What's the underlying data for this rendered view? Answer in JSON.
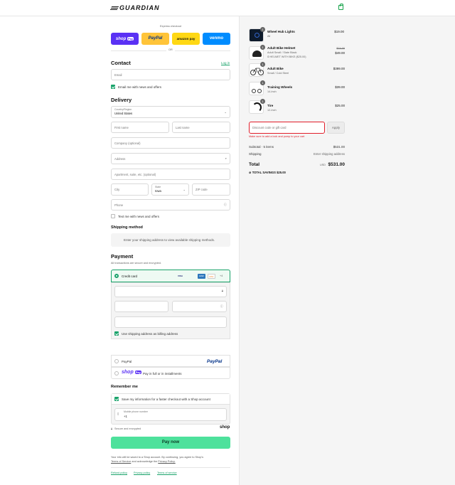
{
  "brand": {
    "name": "GUARDIAN"
  },
  "express": {
    "label": "Express checkout",
    "shop": "shop",
    "shop_pay": "Pay",
    "paypal": "PayPal",
    "amazon": "amazon pay",
    "venmo": "venmo",
    "or": "OR"
  },
  "contact": {
    "title": "Contact",
    "login": "Log in",
    "email_placeholder": "Email",
    "news": "Email me with news and offers"
  },
  "delivery": {
    "title": "Delivery",
    "country_label": "Country/Region",
    "country": "United States",
    "first": "First name",
    "last": "Last name",
    "company": "Company (optional)",
    "address": "Address",
    "apt": "Apartment, suite, etc. (optional)",
    "city": "City",
    "state_label": "State",
    "state": "Iowa",
    "zip": "ZIP code",
    "phone": "Phone",
    "text_me": "Text me with news and offers"
  },
  "shipping": {
    "title": "Shipping method",
    "note": "Enter your shipping address to view available shipping methods."
  },
  "payment": {
    "title": "Payment",
    "sub": "All transactions are secure and encrypted.",
    "credit": "Credit card",
    "cards": [
      "VISA",
      "MC",
      "AMEX",
      "DISC"
    ],
    "more": "+4",
    "billing": "Use shipping address as billing address",
    "paypal": "PayPal",
    "paypal_logo": "PayPal",
    "shop": "shop",
    "shop_pay": "Pay",
    "installments": "Pay in full or in installments"
  },
  "remember": {
    "title": "Remember me",
    "save": "Save my information for a faster checkout with a Shop account",
    "mobile_label": "Mobile phone number",
    "mobile_prefix": "+1",
    "secure": "Secure and encrypted",
    "shop": "shop"
  },
  "pay_button": "Pay now",
  "legal": {
    "line1": "Your info will be saved to a Shop account. By continuing, you agree to Shop's",
    "terms": "Terms of Service",
    "and": "and acknowledge the",
    "privacy": "Privacy Policy."
  },
  "footer": {
    "refund": "Refund policy",
    "privacy": "Privacy policy",
    "terms": "Terms of service"
  },
  "items": [
    {
      "name": "Wheel Hub Lights",
      "variant": "All",
      "qty": "1",
      "price": "$19.00",
      "old": ""
    },
    {
      "name": "Adult Bike Helmet",
      "variant": "Adult Small / Slate Black",
      "qty": "1",
      "price": "$49.00",
      "old": "$74.00",
      "bundle": "HELMET WITH BIKE ($25.00)"
    },
    {
      "name": "Adult Bike",
      "variant": "Small / Cold Steel",
      "qty": "1",
      "price": "$399.00",
      "old": ""
    },
    {
      "name": "Training Wheels",
      "variant": "14-Inch",
      "qty": "1",
      "price": "$39.00",
      "old": ""
    },
    {
      "name": "Tire",
      "variant": "12-Inch",
      "qty": "1",
      "price": "$25.00",
      "old": ""
    }
  ],
  "discount": {
    "placeholder": "Discount code or gift card",
    "apply": "Apply",
    "error": "Make sure to add a lock and pump to your cart"
  },
  "summary": {
    "subtotal_label": "Subtotal · 5 items",
    "subtotal": "$531.00",
    "shipping_label": "Shipping",
    "shipping": "Enter shipping address",
    "total_label": "Total",
    "currency": "USD",
    "total": "$531.00",
    "savings_label": "TOTAL SAVINGS",
    "savings": "$25.00"
  },
  "colors": {
    "accent": "#1aa36b",
    "pay_button": "#4ee19c",
    "error": "#e11d2a",
    "shop_pay": "#5a31f4",
    "paypal_btn": "#ffc439",
    "amazon_btn": "#ffd814",
    "venmo_btn": "#008cff"
  }
}
